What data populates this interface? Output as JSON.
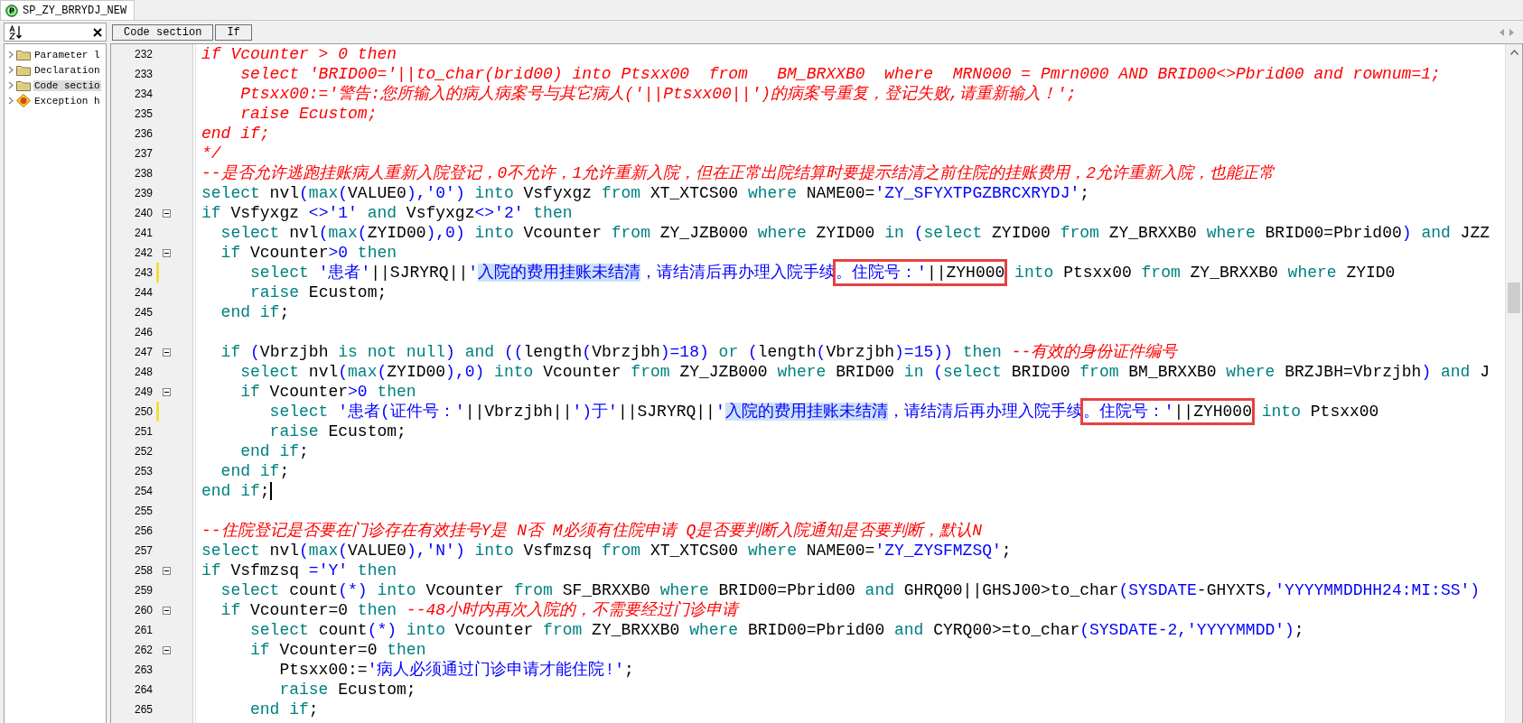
{
  "document_tab": {
    "title": "SP_ZY_BRRYDJ_NEW",
    "selected": true
  },
  "outline": {
    "items": [
      {
        "label": "Parameter l",
        "kind": "folder",
        "selected": false
      },
      {
        "label": "Declaration",
        "kind": "folder",
        "selected": false
      },
      {
        "label": "Code sectio",
        "kind": "folder",
        "selected": true
      },
      {
        "label": "Exception h",
        "kind": "exception",
        "selected": false
      }
    ]
  },
  "breadcrumb": [
    "Code section",
    "If"
  ],
  "editor": {
    "lines": [
      {
        "n": "232",
        "fold": false,
        "changed": false,
        "caret": false,
        "tokens": [
          {
            "kind": "comment",
            "text": "if Vcounter > 0 then"
          }
        ]
      },
      {
        "n": "233",
        "fold": false,
        "changed": false,
        "caret": false,
        "tokens": [
          {
            "kind": "comment",
            "text": "    select 'BRID00='||to_char(brid00) into Ptsxx00  from   BM_BRXXB0  where  MRN000 = Pmrn000 AND BRID00<>Pbrid00 and rownum=1;"
          }
        ]
      },
      {
        "n": "234",
        "fold": false,
        "changed": false,
        "caret": false,
        "tokens": [
          {
            "kind": "comment",
            "text": "    Ptsxx00:='警告:您所输入的病人病案号与其它病人('||Ptsxx00||')的病案号重复，登记失败,请重新输入！';"
          }
        ]
      },
      {
        "n": "235",
        "fold": false,
        "changed": false,
        "caret": false,
        "tokens": [
          {
            "kind": "comment",
            "text": "    raise Ecustom;"
          }
        ]
      },
      {
        "n": "236",
        "fold": false,
        "changed": false,
        "caret": false,
        "tokens": [
          {
            "kind": "comment",
            "text": "end if;"
          }
        ]
      },
      {
        "n": "237",
        "fold": false,
        "changed": false,
        "caret": false,
        "tokens": [
          {
            "kind": "comment",
            "text": "*/"
          }
        ]
      },
      {
        "n": "238",
        "fold": false,
        "changed": false,
        "caret": false,
        "tokens": [
          {
            "kind": "comment",
            "text": "--是否允许逃跑挂账病人重新入院登记，0不允许，1允许重新入院，但在正常出院结算时要提示结清之前住院的挂账费用，2允许重新入院，也能正常"
          }
        ]
      },
      {
        "n": "239",
        "fold": false,
        "changed": false,
        "caret": false,
        "tokens": [
          {
            "kind": "keyword",
            "text": "select"
          },
          {
            "kind": "plain",
            "text": " nvl"
          },
          {
            "kind": "symbol",
            "text": "("
          },
          {
            "kind": "keyword",
            "text": "max"
          },
          {
            "kind": "symbol",
            "text": "("
          },
          {
            "kind": "plain",
            "text": "VALUE0"
          },
          {
            "kind": "symbol",
            "text": "),'0')"
          },
          {
            "kind": "keyword",
            "text": " into"
          },
          {
            "kind": "plain",
            "text": " Vsfyxgz "
          },
          {
            "kind": "keyword",
            "text": "from"
          },
          {
            "kind": "plain",
            "text": " XT_XTCS00 "
          },
          {
            "kind": "keyword",
            "text": "where"
          },
          {
            "kind": "plain",
            "text": " NAME00="
          },
          {
            "kind": "symbol",
            "text": "'ZY_SFYXTPGZBRCXRYDJ'"
          },
          {
            "kind": "plain",
            "text": ";"
          }
        ]
      },
      {
        "n": "240",
        "fold": true,
        "changed": false,
        "caret": false,
        "tokens": [
          {
            "kind": "keyword",
            "text": "if"
          },
          {
            "kind": "plain",
            "text": " Vsfyxgz "
          },
          {
            "kind": "symbol",
            "text": "<>'1'"
          },
          {
            "kind": "keyword",
            "text": " and"
          },
          {
            "kind": "plain",
            "text": " Vsfyxgz"
          },
          {
            "kind": "symbol",
            "text": "<>'2'"
          },
          {
            "kind": "keyword",
            "text": " then"
          }
        ]
      },
      {
        "n": "241",
        "fold": false,
        "changed": false,
        "caret": false,
        "tokens": [
          {
            "kind": "keyword",
            "text": "  select"
          },
          {
            "kind": "plain",
            "text": " nvl"
          },
          {
            "kind": "symbol",
            "text": "("
          },
          {
            "kind": "keyword",
            "text": "max"
          },
          {
            "kind": "symbol",
            "text": "("
          },
          {
            "kind": "plain",
            "text": "ZYID00"
          },
          {
            "kind": "symbol",
            "text": "),0)"
          },
          {
            "kind": "keyword",
            "text": " into"
          },
          {
            "kind": "plain",
            "text": " Vcounter "
          },
          {
            "kind": "keyword",
            "text": "from"
          },
          {
            "kind": "plain",
            "text": " ZY_JZB000 "
          },
          {
            "kind": "keyword",
            "text": "where"
          },
          {
            "kind": "plain",
            "text": " ZYID00 "
          },
          {
            "kind": "keyword",
            "text": "in"
          },
          {
            "kind": "symbol",
            "text": " ("
          },
          {
            "kind": "keyword",
            "text": "select"
          },
          {
            "kind": "plain",
            "text": " ZYID00 "
          },
          {
            "kind": "keyword",
            "text": "from"
          },
          {
            "kind": "plain",
            "text": " ZY_BRXXB0 "
          },
          {
            "kind": "keyword",
            "text": "where"
          },
          {
            "kind": "plain",
            "text": " BRID00=Pbrid00"
          },
          {
            "kind": "symbol",
            "text": ")"
          },
          {
            "kind": "keyword",
            "text": " and"
          },
          {
            "kind": "plain",
            "text": " JZZ"
          }
        ]
      },
      {
        "n": "242",
        "fold": true,
        "changed": false,
        "caret": false,
        "tokens": [
          {
            "kind": "keyword",
            "text": "  if"
          },
          {
            "kind": "plain",
            "text": " Vcounter"
          },
          {
            "kind": "symbol",
            "text": ">0"
          },
          {
            "kind": "keyword",
            "text": " then"
          }
        ]
      },
      {
        "n": "243",
        "fold": false,
        "changed": true,
        "caret": false,
        "tokens": [
          {
            "kind": "keyword",
            "text": "     select"
          },
          {
            "kind": "symbol",
            "text": " '患者'"
          },
          {
            "kind": "plain",
            "text": "||SJRYRQ||"
          },
          {
            "kind": "symbol",
            "text": "'"
          },
          {
            "kind": "selected",
            "text": "入院的费用挂账未结清"
          },
          {
            "kind": "symbol",
            "text": "，请结清后再办理入院手续"
          },
          {
            "kind": "boxed",
            "parts": [
              {
                "kind": "symbol",
                "text": "。住院号：'"
              },
              {
                "kind": "plain",
                "text": "||ZYH000"
              }
            ]
          },
          {
            "kind": "keyword",
            "text": " into"
          },
          {
            "kind": "plain",
            "text": " Ptsxx00 "
          },
          {
            "kind": "keyword",
            "text": "from"
          },
          {
            "kind": "plain",
            "text": " ZY_BRXXB0 "
          },
          {
            "kind": "keyword",
            "text": "where"
          },
          {
            "kind": "plain",
            "text": " ZYID0"
          }
        ]
      },
      {
        "n": "244",
        "fold": false,
        "changed": false,
        "caret": false,
        "tokens": [
          {
            "kind": "keyword",
            "text": "     raise"
          },
          {
            "kind": "plain",
            "text": " Ecustom;"
          }
        ]
      },
      {
        "n": "245",
        "fold": false,
        "changed": false,
        "caret": false,
        "tokens": [
          {
            "kind": "keyword",
            "text": "  end if"
          },
          {
            "kind": "plain",
            "text": ";"
          }
        ]
      },
      {
        "n": "246",
        "fold": false,
        "changed": false,
        "caret": false
      },
      {
        "n": "247",
        "fold": true,
        "changed": false,
        "caret": false,
        "tokens": [
          {
            "kind": "keyword",
            "text": "  if"
          },
          {
            "kind": "symbol",
            "text": " ("
          },
          {
            "kind": "plain",
            "text": "Vbrzjbh "
          },
          {
            "kind": "keyword",
            "text": "is not null"
          },
          {
            "kind": "symbol",
            "text": ")"
          },
          {
            "kind": "keyword",
            "text": " and"
          },
          {
            "kind": "symbol",
            "text": " (("
          },
          {
            "kind": "plain",
            "text": "length"
          },
          {
            "kind": "symbol",
            "text": "("
          },
          {
            "kind": "plain",
            "text": "Vbrzjbh"
          },
          {
            "kind": "symbol",
            "text": ")=18)"
          },
          {
            "kind": "keyword",
            "text": " or"
          },
          {
            "kind": "symbol",
            "text": " ("
          },
          {
            "kind": "plain",
            "text": "length"
          },
          {
            "kind": "symbol",
            "text": "("
          },
          {
            "kind": "plain",
            "text": "Vbrzjbh"
          },
          {
            "kind": "symbol",
            "text": ")=15))"
          },
          {
            "kind": "keyword",
            "text": " then"
          },
          {
            "kind": "comment",
            "text": " --有效的身份证件编号"
          }
        ]
      },
      {
        "n": "248",
        "fold": false,
        "changed": false,
        "caret": false,
        "tokens": [
          {
            "kind": "keyword",
            "text": "    select"
          },
          {
            "kind": "plain",
            "text": " nvl"
          },
          {
            "kind": "symbol",
            "text": "("
          },
          {
            "kind": "keyword",
            "text": "max"
          },
          {
            "kind": "symbol",
            "text": "("
          },
          {
            "kind": "plain",
            "text": "ZYID00"
          },
          {
            "kind": "symbol",
            "text": "),0)"
          },
          {
            "kind": "keyword",
            "text": " into"
          },
          {
            "kind": "plain",
            "text": " Vcounter "
          },
          {
            "kind": "keyword",
            "text": "from"
          },
          {
            "kind": "plain",
            "text": " ZY_JZB000 "
          },
          {
            "kind": "keyword",
            "text": "where"
          },
          {
            "kind": "plain",
            "text": " BRID00 "
          },
          {
            "kind": "keyword",
            "text": "in"
          },
          {
            "kind": "symbol",
            "text": " ("
          },
          {
            "kind": "keyword",
            "text": "select"
          },
          {
            "kind": "plain",
            "text": " BRID00 "
          },
          {
            "kind": "keyword",
            "text": "from"
          },
          {
            "kind": "plain",
            "text": " BM_BRXXB0 "
          },
          {
            "kind": "keyword",
            "text": "where"
          },
          {
            "kind": "plain",
            "text": " BRZJBH=Vbrzjbh"
          },
          {
            "kind": "symbol",
            "text": ")"
          },
          {
            "kind": "keyword",
            "text": " and"
          },
          {
            "kind": "plain",
            "text": " J"
          }
        ]
      },
      {
        "n": "249",
        "fold": true,
        "changed": false,
        "caret": false,
        "tokens": [
          {
            "kind": "keyword",
            "text": "    if"
          },
          {
            "kind": "plain",
            "text": " Vcounter"
          },
          {
            "kind": "symbol",
            "text": ">0"
          },
          {
            "kind": "keyword",
            "text": " then"
          }
        ]
      },
      {
        "n": "250",
        "fold": false,
        "changed": true,
        "caret": false,
        "tokens": [
          {
            "kind": "keyword",
            "text": "       select"
          },
          {
            "kind": "symbol",
            "text": " '患者(证件号：'"
          },
          {
            "kind": "plain",
            "text": "||Vbrzjbh||"
          },
          {
            "kind": "symbol",
            "text": "')于'"
          },
          {
            "kind": "plain",
            "text": "||SJRYRQ||"
          },
          {
            "kind": "symbol",
            "text": "'"
          },
          {
            "kind": "selected",
            "text": "入院的费用挂账未结清"
          },
          {
            "kind": "symbol",
            "text": "，请结清后再办理入院手续"
          },
          {
            "kind": "boxed",
            "parts": [
              {
                "kind": "symbol",
                "text": "。住院号：'"
              },
              {
                "kind": "plain",
                "text": "||ZYH000"
              }
            ]
          },
          {
            "kind": "keyword",
            "text": " into"
          },
          {
            "kind": "plain",
            "text": " Ptsxx00"
          }
        ]
      },
      {
        "n": "251",
        "fold": false,
        "changed": false,
        "caret": false,
        "tokens": [
          {
            "kind": "keyword",
            "text": "       raise"
          },
          {
            "kind": "plain",
            "text": " Ecustom;"
          }
        ]
      },
      {
        "n": "252",
        "fold": false,
        "changed": false,
        "caret": false,
        "tokens": [
          {
            "kind": "keyword",
            "text": "    end if"
          },
          {
            "kind": "plain",
            "text": ";"
          }
        ]
      },
      {
        "n": "253",
        "fold": false,
        "changed": false,
        "caret": false,
        "tokens": [
          {
            "kind": "keyword",
            "text": "  end if"
          },
          {
            "kind": "plain",
            "text": ";"
          }
        ]
      },
      {
        "n": "254",
        "fold": false,
        "changed": false,
        "caret": true,
        "tokens": [
          {
            "kind": "keyword",
            "text": "end if"
          },
          {
            "kind": "plain",
            "text": ";"
          }
        ]
      },
      {
        "n": "255",
        "fold": false,
        "changed": false,
        "caret": false
      },
      {
        "n": "256",
        "fold": false,
        "changed": false,
        "caret": false,
        "tokens": [
          {
            "kind": "comment",
            "text": "--住院登记是否要在门诊存在有效挂号Y是 N否 M必须有住院申请 Q是否要判断入院通知是否要判断，默认N"
          }
        ]
      },
      {
        "n": "257",
        "fold": false,
        "changed": false,
        "caret": false,
        "tokens": [
          {
            "kind": "keyword",
            "text": "select"
          },
          {
            "kind": "plain",
            "text": " nvl"
          },
          {
            "kind": "symbol",
            "text": "("
          },
          {
            "kind": "keyword",
            "text": "max"
          },
          {
            "kind": "symbol",
            "text": "("
          },
          {
            "kind": "plain",
            "text": "VALUE0"
          },
          {
            "kind": "symbol",
            "text": "),'N')"
          },
          {
            "kind": "keyword",
            "text": " into"
          },
          {
            "kind": "plain",
            "text": " Vsfmzsq "
          },
          {
            "kind": "keyword",
            "text": "from"
          },
          {
            "kind": "plain",
            "text": " XT_XTCS00 "
          },
          {
            "kind": "keyword",
            "text": "where"
          },
          {
            "kind": "plain",
            "text": " NAME00="
          },
          {
            "kind": "symbol",
            "text": "'ZY_ZYSFMZSQ'"
          },
          {
            "kind": "plain",
            "text": ";"
          }
        ]
      },
      {
        "n": "258",
        "fold": true,
        "changed": false,
        "caret": false,
        "tokens": [
          {
            "kind": "keyword",
            "text": "if"
          },
          {
            "kind": "plain",
            "text": " Vsfmzsq "
          },
          {
            "kind": "symbol",
            "text": "='Y'"
          },
          {
            "kind": "keyword",
            "text": " then"
          }
        ]
      },
      {
        "n": "259",
        "fold": false,
        "changed": false,
        "caret": false,
        "tokens": [
          {
            "kind": "keyword",
            "text": "  select"
          },
          {
            "kind": "plain",
            "text": " count"
          },
          {
            "kind": "symbol",
            "text": "(*)"
          },
          {
            "kind": "keyword",
            "text": " into"
          },
          {
            "kind": "plain",
            "text": " Vcounter "
          },
          {
            "kind": "keyword",
            "text": "from"
          },
          {
            "kind": "plain",
            "text": " SF_BRXXB0 "
          },
          {
            "kind": "keyword",
            "text": "where"
          },
          {
            "kind": "plain",
            "text": " BRID00=Pbrid00 "
          },
          {
            "kind": "keyword",
            "text": "and"
          },
          {
            "kind": "plain",
            "text": " GHRQ00||GHSJ00>to_char"
          },
          {
            "kind": "symbol",
            "text": "(SYSDATE"
          },
          {
            "kind": "plain",
            "text": "-GHYXTS"
          },
          {
            "kind": "symbol",
            "text": ",'YYYYMMDDHH24:MI:SS')"
          }
        ]
      },
      {
        "n": "260",
        "fold": true,
        "changed": false,
        "caret": false,
        "tokens": [
          {
            "kind": "keyword",
            "text": "  if"
          },
          {
            "kind": "plain",
            "text": " Vcounter=0 "
          },
          {
            "kind": "keyword",
            "text": "then"
          },
          {
            "kind": "comment",
            "text": " --48小时内再次入院的，不需要经过门诊申请"
          }
        ]
      },
      {
        "n": "261",
        "fold": false,
        "changed": false,
        "caret": false,
        "tokens": [
          {
            "kind": "keyword",
            "text": "     select"
          },
          {
            "kind": "plain",
            "text": " count"
          },
          {
            "kind": "symbol",
            "text": "(*)"
          },
          {
            "kind": "keyword",
            "text": " into"
          },
          {
            "kind": "plain",
            "text": " Vcounter "
          },
          {
            "kind": "keyword",
            "text": "from"
          },
          {
            "kind": "plain",
            "text": " ZY_BRXXB0 "
          },
          {
            "kind": "keyword",
            "text": "where"
          },
          {
            "kind": "plain",
            "text": " BRID00=Pbrid00 "
          },
          {
            "kind": "keyword",
            "text": "and"
          },
          {
            "kind": "plain",
            "text": " CYRQ00>=to_char"
          },
          {
            "kind": "symbol",
            "text": "(SYSDATE-2,'YYYYMMDD')"
          },
          {
            "kind": "plain",
            "text": ";"
          }
        ]
      },
      {
        "n": "262",
        "fold": true,
        "changed": false,
        "caret": false,
        "tokens": [
          {
            "kind": "keyword",
            "text": "     if"
          },
          {
            "kind": "plain",
            "text": " Vcounter=0 "
          },
          {
            "kind": "keyword",
            "text": "then"
          }
        ]
      },
      {
        "n": "263",
        "fold": false,
        "changed": false,
        "caret": false,
        "tokens": [
          {
            "kind": "plain",
            "text": "        Ptsxx00:="
          },
          {
            "kind": "symbol",
            "text": "'病人必须通过门诊申请才能住院!'"
          },
          {
            "kind": "plain",
            "text": ";"
          }
        ]
      },
      {
        "n": "264",
        "fold": false,
        "changed": false,
        "caret": false,
        "tokens": [
          {
            "kind": "keyword",
            "text": "        raise"
          },
          {
            "kind": "plain",
            "text": " Ecustom;"
          }
        ]
      },
      {
        "n": "265",
        "fold": false,
        "changed": false,
        "caret": false,
        "tokens": [
          {
            "kind": "keyword",
            "text": "     end if"
          },
          {
            "kind": "plain",
            "text": ";"
          }
        ]
      }
    ]
  }
}
